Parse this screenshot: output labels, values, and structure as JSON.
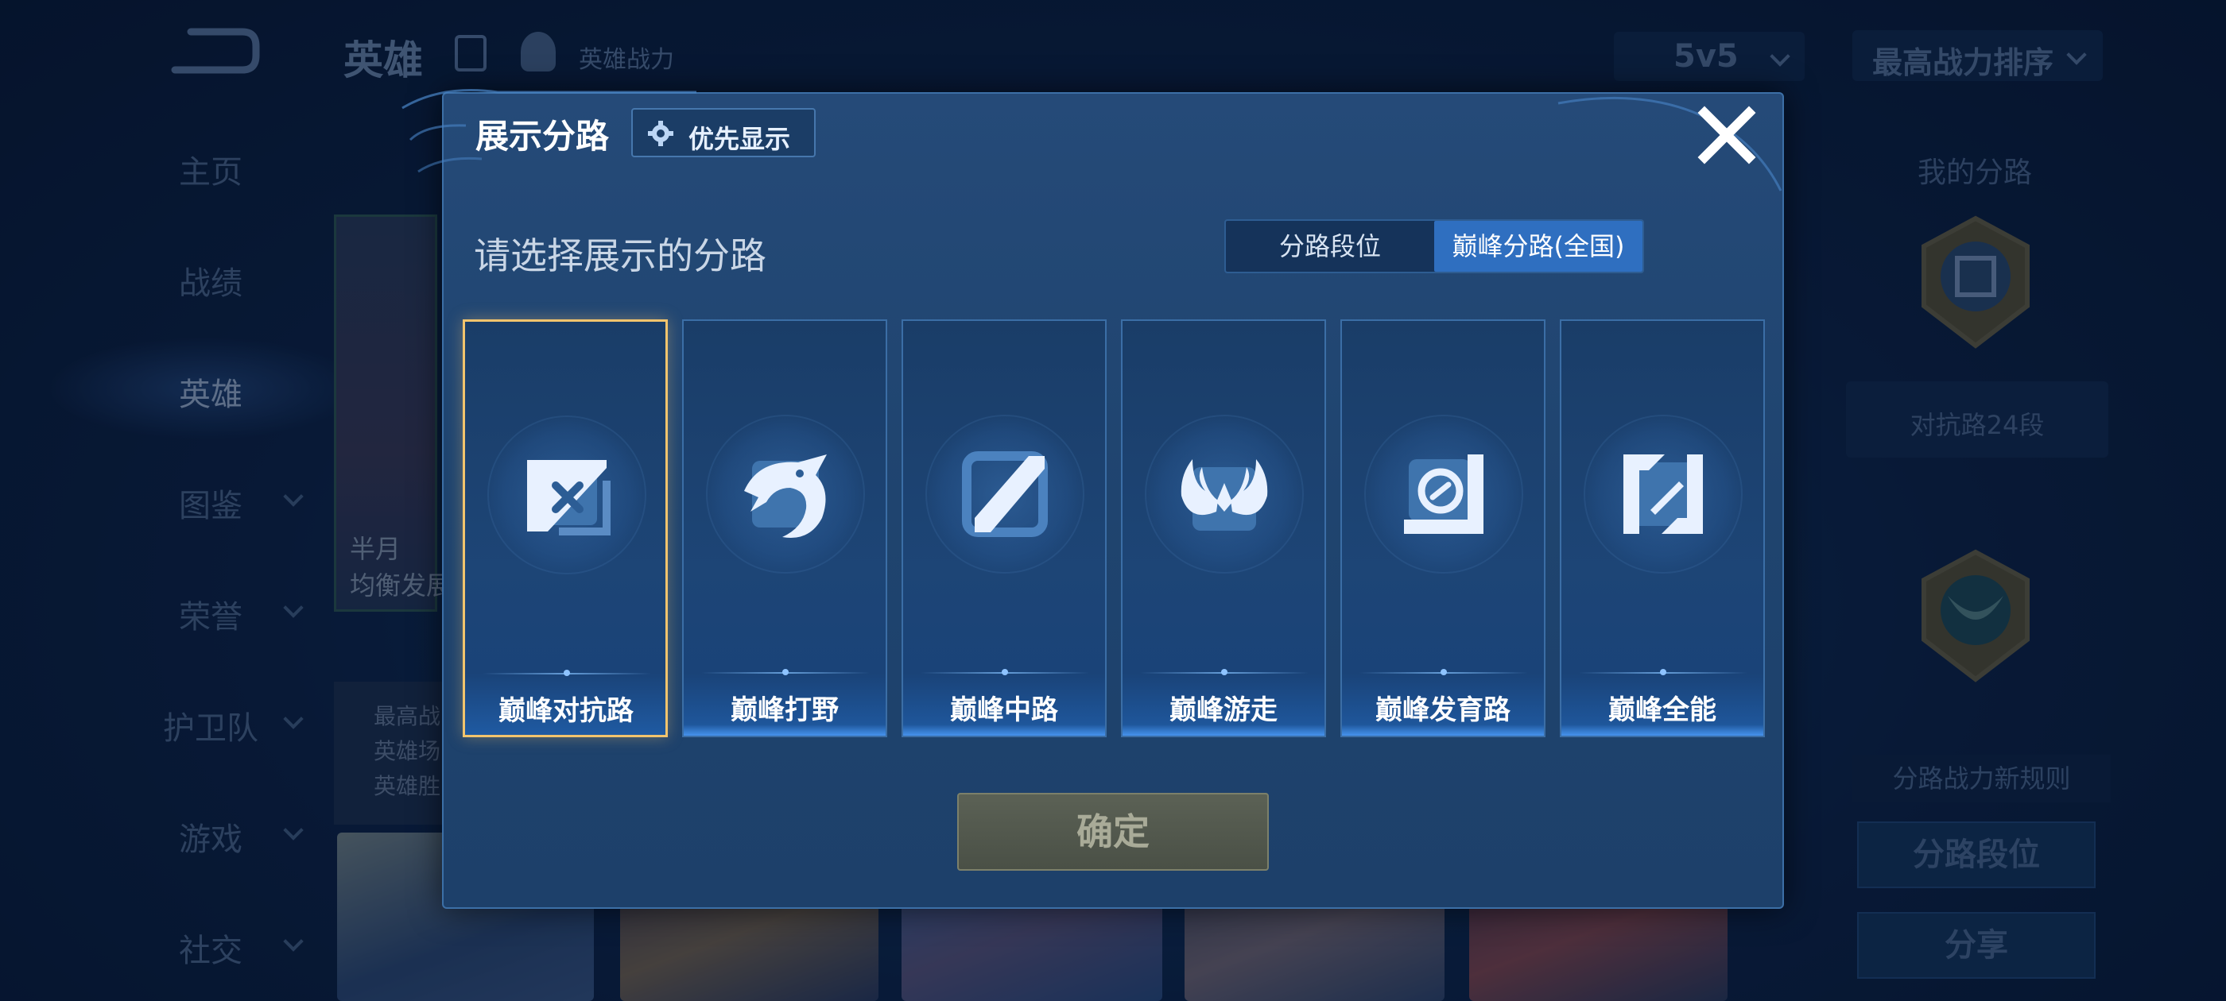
{
  "header": {
    "title": "英雄",
    "power_label": "英雄战力",
    "mode": "5v5",
    "sort": "最高战力排序"
  },
  "sidebar": {
    "items": [
      {
        "label": "主页"
      },
      {
        "label": "战绩"
      },
      {
        "label": "英雄"
      },
      {
        "label": "图鉴"
      },
      {
        "label": "荣誉"
      },
      {
        "label": "护卫队"
      },
      {
        "label": "游戏"
      },
      {
        "label": "社交"
      }
    ]
  },
  "hero_card": {
    "name_partial": "半月",
    "role_partial": "均衡发展",
    "stats": [
      "最高战",
      "英雄场",
      "英雄胜"
    ]
  },
  "right_panel": {
    "my_lanes": "我的分路",
    "rank": "对抗路24段",
    "rules": "分路战力新规则",
    "lane_rank_button": "分路段位",
    "share_button": "分享"
  },
  "modal": {
    "title": "展示分路",
    "priority_button": "优先显示",
    "subtitle": "请选择展示的分路",
    "tabs": [
      {
        "label": "分路段位",
        "active": false
      },
      {
        "label": "巅峰分路(全国)",
        "active": true
      }
    ],
    "lanes": [
      {
        "label": "巅峰对抗路",
        "icon": "clash-lane-icon",
        "selected": true
      },
      {
        "label": "巅峰打野",
        "icon": "jungle-dragon-icon",
        "selected": false
      },
      {
        "label": "巅峰中路",
        "icon": "mid-lane-icon",
        "selected": false
      },
      {
        "label": "巅峰游走",
        "icon": "roam-wings-icon",
        "selected": false
      },
      {
        "label": "巅峰发育路",
        "icon": "farm-lane-icon",
        "selected": false
      },
      {
        "label": "巅峰全能",
        "icon": "all-round-icon",
        "selected": false
      }
    ],
    "confirm_button": "确定"
  },
  "colors": {
    "accent_blue": "#2f6fc0",
    "selected_border": "#f2c46d",
    "modal_bg": "#214772"
  }
}
